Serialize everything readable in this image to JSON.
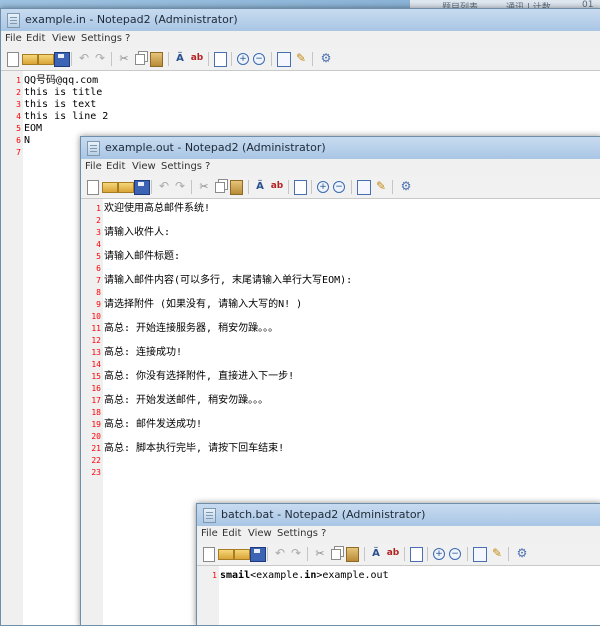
{
  "background_strip": {
    "text1": "题目列表",
    "text2": "通讯 | 计数",
    "text3": "01"
  },
  "menu_labels": [
    "File",
    "Edit",
    "View",
    "Settings",
    "?"
  ],
  "window_in": {
    "title": "example.in - Notepad2 (Administrator)",
    "lines": [
      {
        "n": "1",
        "text": "QQ号码@qq.com"
      },
      {
        "n": "2",
        "text": "this is title"
      },
      {
        "n": "3",
        "text": "this is text"
      },
      {
        "n": "4",
        "text": "this is line 2"
      },
      {
        "n": "5",
        "text": "EOM"
      },
      {
        "n": "6",
        "text": "N"
      },
      {
        "n": "7",
        "text": ""
      }
    ]
  },
  "window_out": {
    "title": "example.out - Notepad2 (Administrator)",
    "lines": [
      {
        "n": "1",
        "text": "欢迎使用高总邮件系统!"
      },
      {
        "n": "2",
        "text": ""
      },
      {
        "n": "3",
        "text": "请输入收件人:"
      },
      {
        "n": "4",
        "text": ""
      },
      {
        "n": "5",
        "text": "请输入邮件标题:"
      },
      {
        "n": "6",
        "text": ""
      },
      {
        "n": "7",
        "text": "请输入邮件内容(可以多行, 末尾请输入单行大写EOM):"
      },
      {
        "n": "8",
        "text": ""
      },
      {
        "n": "9",
        "text": "请选择附件 (如果没有, 请输入大写的N! )"
      },
      {
        "n": "10",
        "text": ""
      },
      {
        "n": "11",
        "text": "高总: 开始连接服务器, 稍安勿躁。。。"
      },
      {
        "n": "12",
        "text": ""
      },
      {
        "n": "13",
        "text": "高总: 连接成功!"
      },
      {
        "n": "14",
        "text": ""
      },
      {
        "n": "15",
        "text": "高总: 你没有选择附件, 直接进入下一步!"
      },
      {
        "n": "16",
        "text": ""
      },
      {
        "n": "17",
        "text": "高总: 开始发送邮件, 稍安勿躁。。。"
      },
      {
        "n": "18",
        "text": ""
      },
      {
        "n": "19",
        "text": "高总: 邮件发送成功!"
      },
      {
        "n": "20",
        "text": ""
      },
      {
        "n": "21",
        "text": "高总: 脚本执行完毕, 请按下回车结束!"
      },
      {
        "n": "22",
        "text": ""
      },
      {
        "n": "23",
        "text": ""
      }
    ]
  },
  "window_bat": {
    "title": "batch.bat - Notepad2 (Administrator)",
    "lines": [
      {
        "n": "1",
        "text_a": "smail",
        "text_b": "<example.",
        "text_c": "in",
        "text_d": ">example.out"
      }
    ]
  }
}
